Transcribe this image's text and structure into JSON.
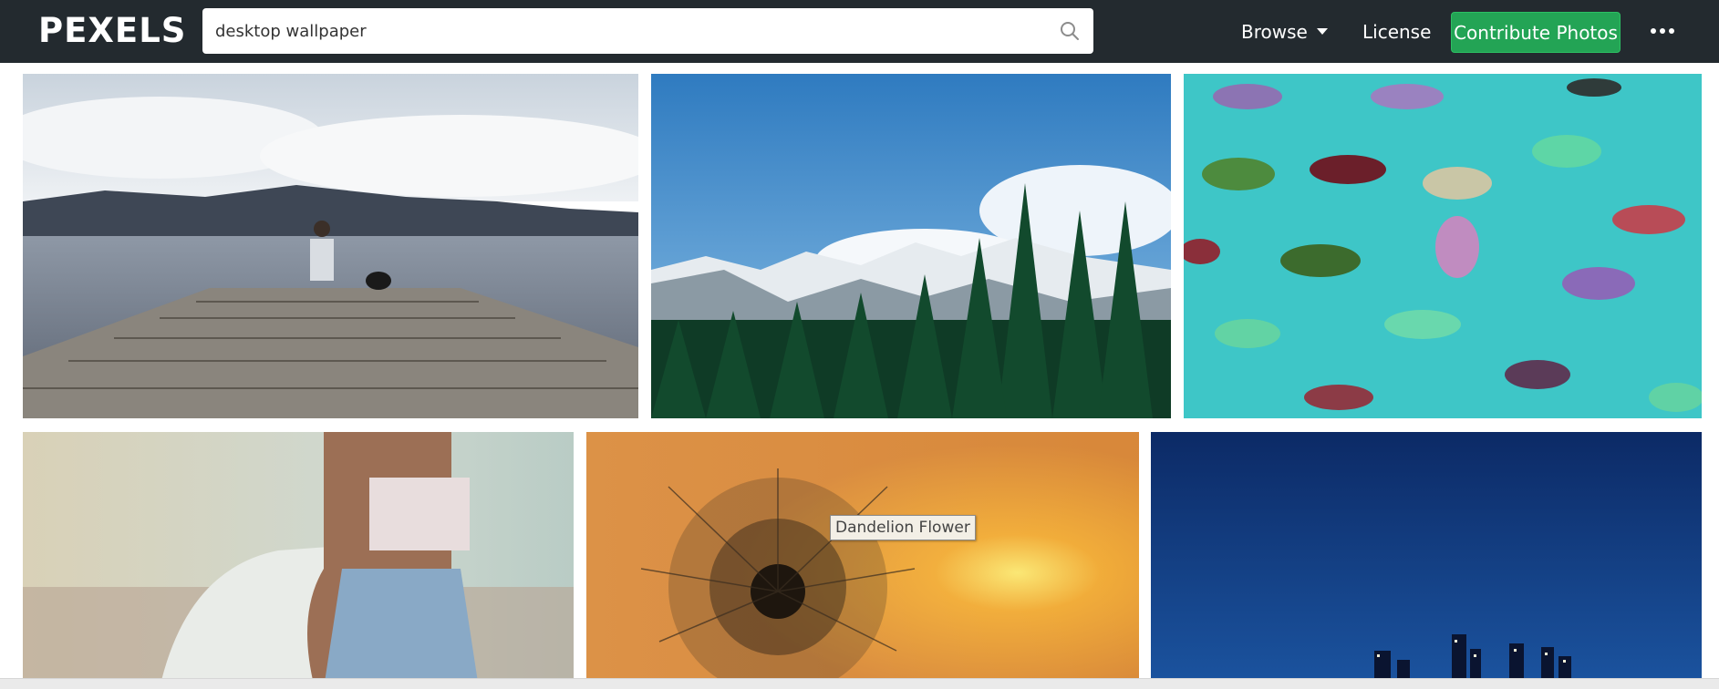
{
  "header": {
    "logo_text": "PEXELS",
    "search": {
      "value": "desktop wallpaper",
      "placeholder": ""
    },
    "nav": {
      "browse": "Browse",
      "license": "License",
      "contribute": "Contribute Photos"
    },
    "colors": {
      "bar": "#232a2f",
      "accent": "#23a455"
    }
  },
  "gallery": {
    "photos": [
      {
        "id": "pier"
      },
      {
        "id": "mountains-forest"
      },
      {
        "id": "toy-dinosaurs"
      },
      {
        "id": "woman-car"
      },
      {
        "id": "dandelion"
      },
      {
        "id": "city-night"
      }
    ],
    "hover_tooltip": "Dandelion Flower"
  }
}
